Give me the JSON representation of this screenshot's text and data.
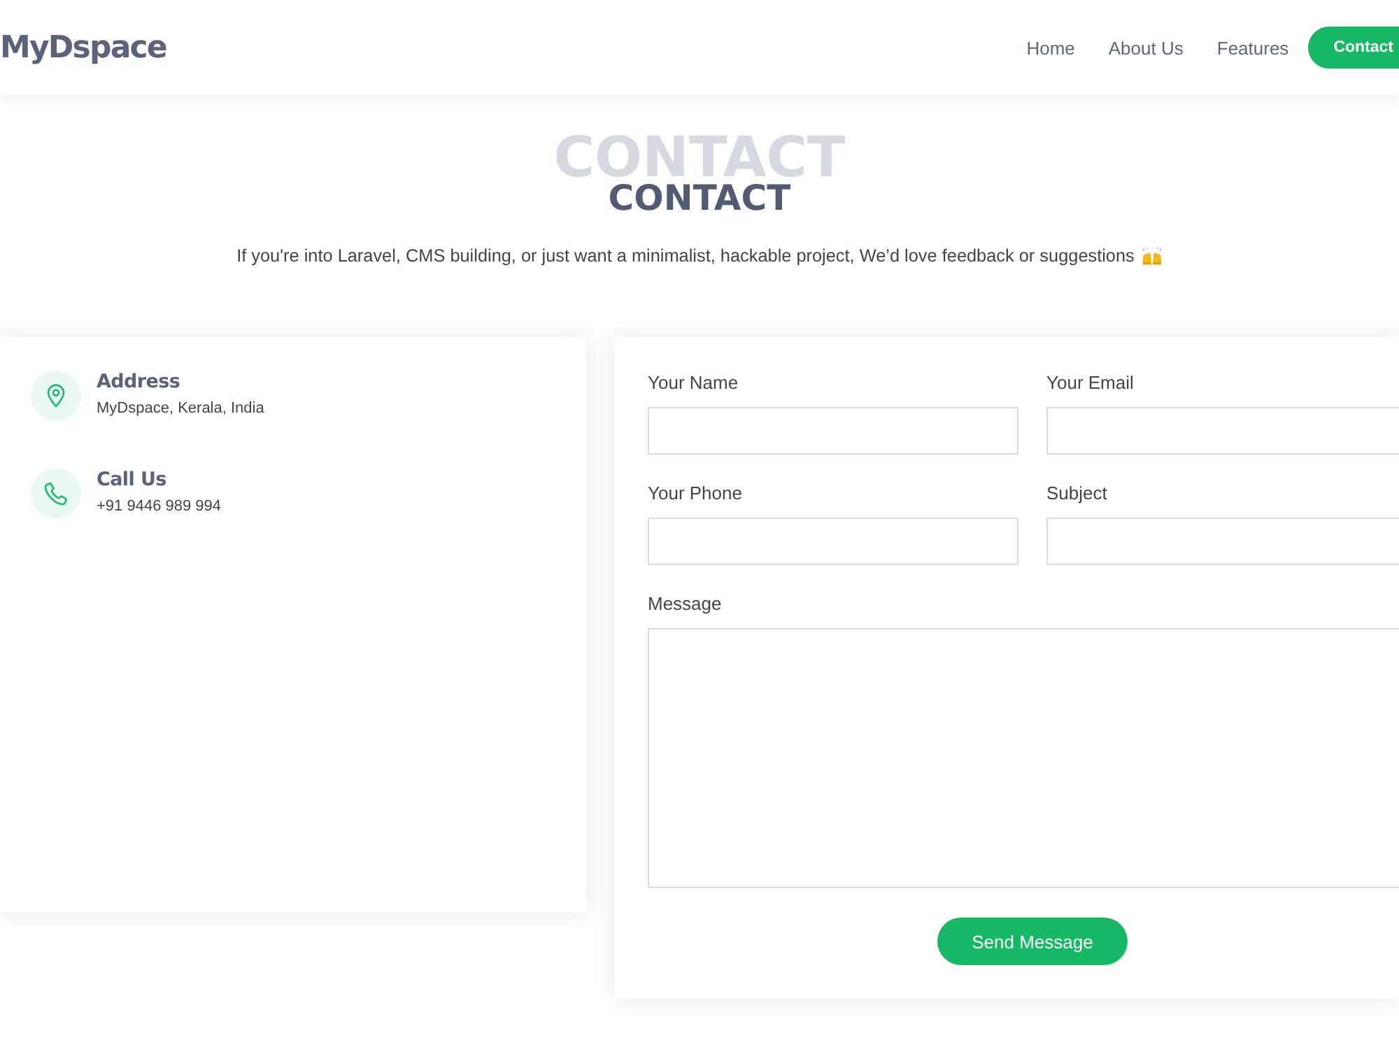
{
  "header": {
    "logo": "MyDspace",
    "nav": [
      {
        "label": "Home",
        "kind": "link"
      },
      {
        "label": "About Us",
        "kind": "link"
      },
      {
        "label": "Features",
        "kind": "link"
      },
      {
        "label": "Contact",
        "kind": "button"
      }
    ]
  },
  "section": {
    "background_title": "CONTACT",
    "title": "CONTACT",
    "subtitle": "If you're into Laravel, CMS building, or just want a minimalist, hackable project, We’d love feedback or suggestions"
  },
  "info": [
    {
      "kind": "address",
      "title": "Address",
      "text": "MyDspace, Kerala, India"
    },
    {
      "kind": "phone",
      "title": "Call Us",
      "text": "+91 9446 989 994"
    }
  ],
  "form": {
    "fields": [
      {
        "label": "Your Name",
        "kind": "input"
      },
      {
        "label": "Your Email",
        "kind": "input"
      },
      {
        "label": "Your Phone",
        "kind": "input"
      },
      {
        "label": "Subject",
        "kind": "input"
      },
      {
        "label": "Message",
        "kind": "textarea"
      }
    ],
    "submit": "Send Message"
  }
}
